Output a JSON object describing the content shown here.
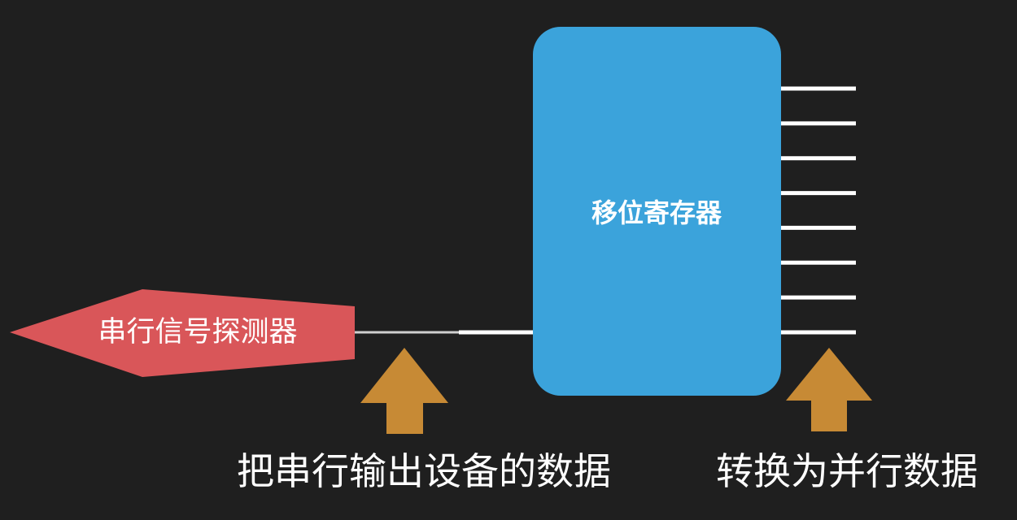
{
  "register": {
    "label": "移位寄存器",
    "fill": "#3ba3db",
    "output_line_count": 8
  },
  "detector": {
    "label": "串行信号探测器",
    "fill": "#d95659"
  },
  "captions": {
    "left": "把串行输出设备的数据",
    "right": "转换为并行数据"
  },
  "colors": {
    "background": "#1f1f1f",
    "arrow": "#c78a35",
    "line": "#ffffff",
    "text": "#ffffff"
  }
}
